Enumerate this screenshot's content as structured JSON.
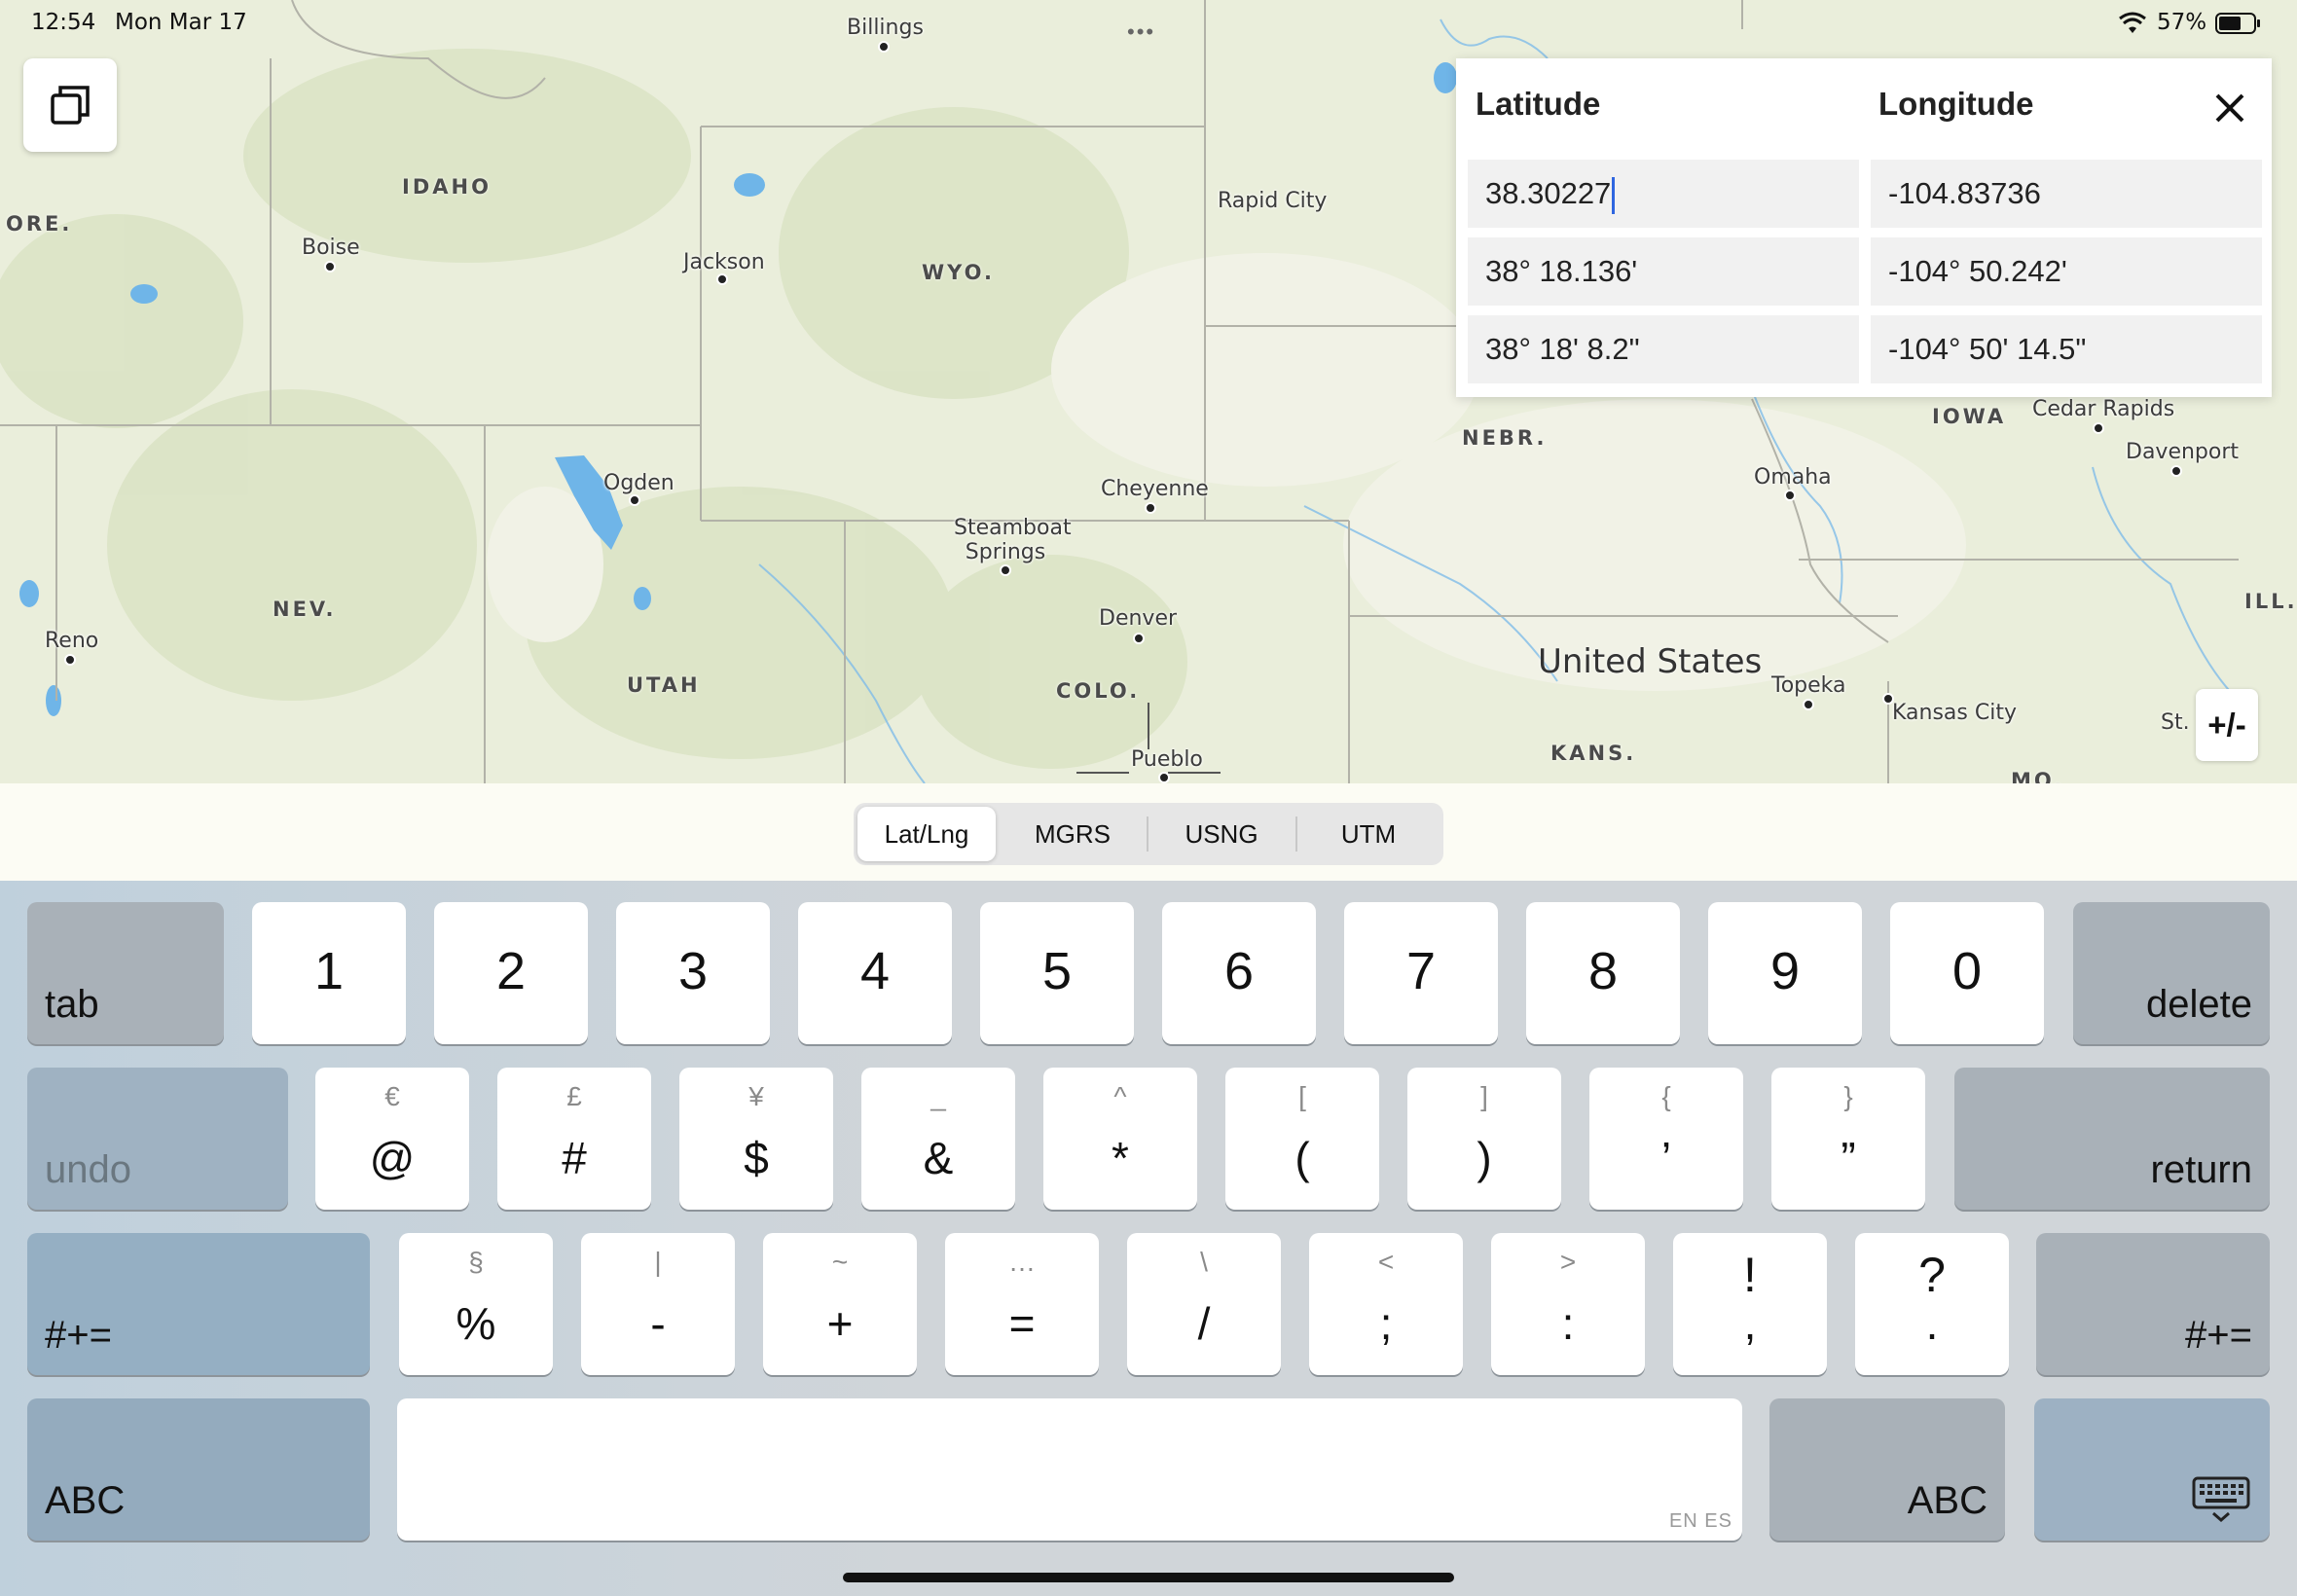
{
  "status_bar": {
    "time": "12:54",
    "date": "Mon Mar 17",
    "battery": "57%"
  },
  "map": {
    "cities": [
      {
        "name": "Billings"
      },
      {
        "name": "Rapid City"
      },
      {
        "name": "Boise"
      },
      {
        "name": "Jackson"
      },
      {
        "name": "Ogden"
      },
      {
        "name": "Cheyenne"
      },
      {
        "name": "Steamboat Springs"
      },
      {
        "name": "Reno"
      },
      {
        "name": "Denver"
      },
      {
        "name": "Pueblo"
      },
      {
        "name": "Omaha"
      },
      {
        "name": "Cedar Rapids"
      },
      {
        "name": "Davenport"
      },
      {
        "name": "Topeka"
      },
      {
        "name": "Kansas City"
      },
      {
        "name": "St."
      }
    ],
    "states": [
      "IDAHO",
      "ORE.",
      "WYO.",
      "NEV.",
      "UTAH",
      "COLO.",
      "NEBR.",
      "IOWA",
      "KANS.",
      "ILL.",
      "MO."
    ],
    "country": "United States"
  },
  "coords_panel": {
    "latitude_label": "Latitude",
    "longitude_label": "Longitude",
    "rows": [
      {
        "lat": "38.30227",
        "lng": "-104.83736"
      },
      {
        "lat": "38° 18.136'",
        "lng": "-104° 50.242'"
      },
      {
        "lat": "38° 18' 8.2\"",
        "lng": "-104° 50' 14.5\""
      }
    ]
  },
  "plus_minus_label": "+/-",
  "formats": {
    "items": [
      "Lat/Lng",
      "MGRS",
      "USNG",
      "UTM"
    ],
    "active": "Lat/Lng"
  },
  "keyboard": {
    "row1": {
      "tab": "tab",
      "keys": [
        "1",
        "2",
        "3",
        "4",
        "5",
        "6",
        "7",
        "8",
        "9",
        "0"
      ],
      "delete": "delete"
    },
    "row2": {
      "undo": "undo",
      "keys": [
        {
          "main": "@",
          "sub": "€"
        },
        {
          "main": "#",
          "sub": "£"
        },
        {
          "main": "$",
          "sub": "¥"
        },
        {
          "main": "&",
          "sub": "_"
        },
        {
          "main": "*",
          "sub": "^"
        },
        {
          "main": "(",
          "sub": "["
        },
        {
          "main": ")",
          "sub": "]"
        },
        {
          "main": "’",
          "sub": "{"
        },
        {
          "main": "”",
          "sub": "}"
        }
      ],
      "return": "return"
    },
    "row3": {
      "left": "#+=",
      "keys": [
        {
          "main": "%",
          "sub": "§"
        },
        {
          "main": "-",
          "sub": "|"
        },
        {
          "main": "+",
          "sub": "~"
        },
        {
          "main": "=",
          "sub": "…"
        },
        {
          "main": "/",
          "sub": "\\"
        },
        {
          "main": ";",
          "sub": "<"
        },
        {
          "main": ":",
          "sub": ">"
        },
        {
          "main": ",",
          "sub": "!"
        },
        {
          "main": ".",
          "sub": "?"
        }
      ],
      "right": "#+="
    },
    "row4": {
      "abc_left": "ABC",
      "space_hint": "EN ES",
      "abc_right": "ABC"
    }
  }
}
